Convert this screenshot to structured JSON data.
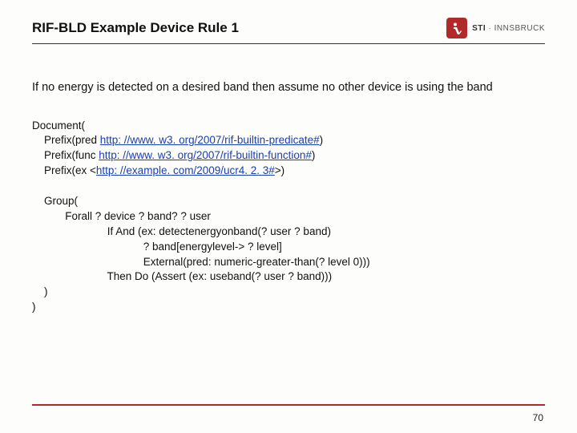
{
  "header": {
    "title": "RIF-BLD Example Device Rule 1",
    "logo": {
      "brand": "STI",
      "sep": " · ",
      "sub": "INNSBRUCK"
    }
  },
  "intro": "If no energy is detected on a desired band then assume no other device is using the band",
  "code": {
    "l1": "Document(",
    "l2": "    Prefix(pred ",
    "l2_link": "http: //www. w3. org/2007/rif-builtin-predicate#",
    "l2_end": ")",
    "l3": "    Prefix(func ",
    "l3_link": "http: //www. w3. org/2007/rif-builtin-function#",
    "l3_end": ")",
    "l4": "    Prefix(ex <",
    "l4_link": "http: //example. com/2009/ucr4. 2. 3#",
    "l4_end": ">)",
    "l5": "",
    "l6": "    Group(",
    "l7": "           Forall ? device ? band? ? user",
    "l8": "                         If And (ex: detectenergyonband(? user ? band)",
    "l9": "                                     ? band[energylevel-> ? level]",
    "l10": "                                     External(pred: numeric-greater-than(? level 0)))",
    "l11": "                         Then Do (Assert (ex: useband(? user ? band)))",
    "l12": "    )",
    "l13": ")"
  },
  "page": "70"
}
